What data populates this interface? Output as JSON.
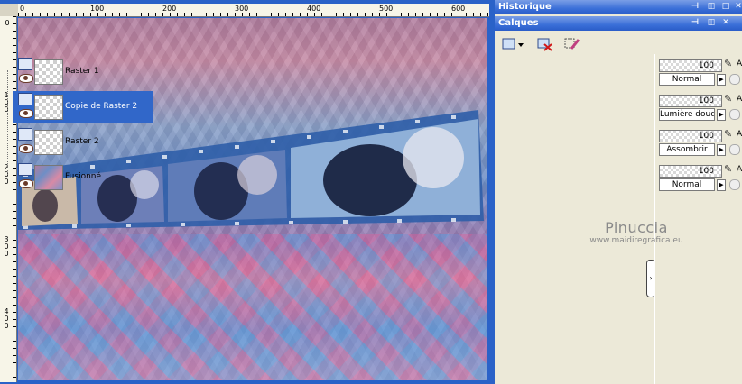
{
  "ruler": {
    "top_labels": [
      "0",
      "100",
      "200",
      "300",
      "400",
      "500",
      "600"
    ],
    "left_labels": [
      "0",
      "100",
      "200",
      "300",
      "400"
    ]
  },
  "panels": {
    "historique_title": "Historique",
    "calques_title": "Calques"
  },
  "layers": [
    {
      "name": "Raster 1",
      "opacity": "100",
      "blend": "Normal",
      "selected": false
    },
    {
      "name": "Copie de Raster 2",
      "opacity": "100",
      "blend": "Lumière douce",
      "selected": true
    },
    {
      "name": "Raster 2",
      "opacity": "100",
      "blend": "Assombrir",
      "selected": false
    },
    {
      "name": "Fusionné",
      "opacity": "100",
      "blend": "Normal",
      "selected": false
    }
  ],
  "props_label": "A",
  "watermark": {
    "name": "Pinuccia",
    "url": "www.maidiregrafica.eu"
  },
  "colors": {
    "titlebar": "#3a6fd8",
    "selection": "#3167c9",
    "panel_bg": "#ece9d8",
    "workspace": "#2a62c8"
  }
}
